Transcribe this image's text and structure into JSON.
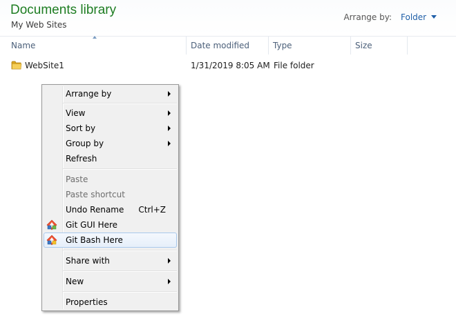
{
  "header": {
    "title": "Documents library",
    "subtitle": "My Web Sites",
    "arrange_by_label": "Arrange by:",
    "arrange_by_value": "Folder",
    "title_color": "#1e7d22",
    "link_color": "#1f5fa8"
  },
  "columns": {
    "name": "Name",
    "date_modified": "Date modified",
    "type": "Type",
    "size": "Size",
    "sorted_column": "name"
  },
  "files": [
    {
      "icon": "folder-icon",
      "name": "WebSite1",
      "date_modified": "1/31/2019 8:05 AM",
      "type": "File folder",
      "size": ""
    }
  ],
  "context_menu": {
    "items": [
      {
        "label": "Arrange by",
        "submenu": true
      },
      {
        "separator": true
      },
      {
        "label": "View",
        "submenu": true
      },
      {
        "label": "Sort by",
        "submenu": true
      },
      {
        "label": "Group by",
        "submenu": true
      },
      {
        "label": "Refresh"
      },
      {
        "separator": true
      },
      {
        "label": "Paste",
        "disabled": true
      },
      {
        "label": "Paste shortcut",
        "disabled": true
      },
      {
        "label": "Undo Rename",
        "shortcut": "Ctrl+Z"
      },
      {
        "label": "Git GUI Here",
        "icon": "git-gui-icon"
      },
      {
        "label": "Git Bash Here",
        "icon": "git-bash-icon",
        "highlighted": true
      },
      {
        "separator": true
      },
      {
        "label": "Share with",
        "submenu": true
      },
      {
        "separator": true
      },
      {
        "label": "New",
        "submenu": true
      },
      {
        "separator": true
      },
      {
        "label": "Properties"
      }
    ]
  }
}
